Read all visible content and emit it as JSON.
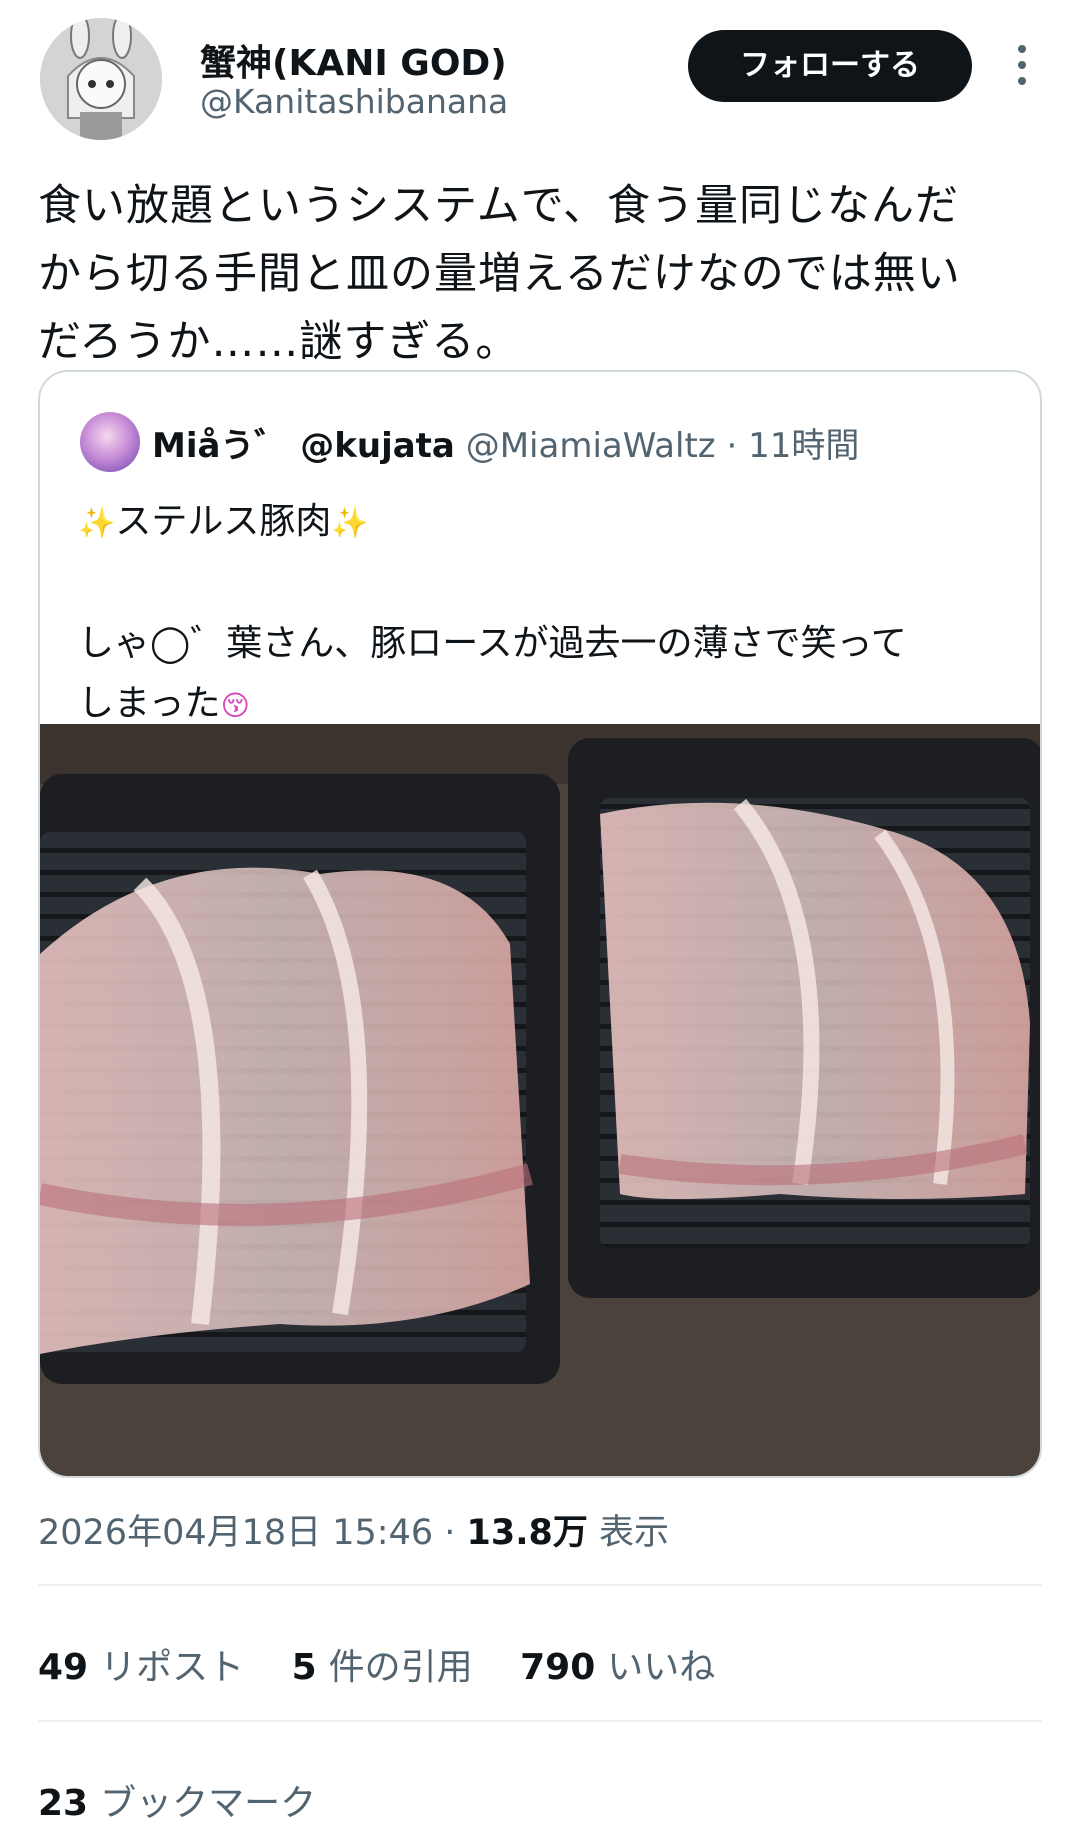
{
  "author": {
    "display_name": "蟹神(KANI GOD)",
    "handle": "@Kanitashibanana",
    "follow_label": "フォローする"
  },
  "tweet": {
    "lines": [
      "食い放題というシステムで、食う量同じなんだ",
      "から切る手間と皿の量増えるだけなのでは無い",
      "だろうか……謎すぎる。"
    ]
  },
  "quote": {
    "display_name": "Miåう゛ @kujata",
    "handle": "@MiamiaWaltz",
    "time": "11時間",
    "title_text": "ステルス豚肉",
    "body_lines": [
      "しゃ◯゛葉さん、豚ロースが過去一の薄さで笑って",
      "しまった"
    ],
    "sparkle_icon": "sparkles-icon",
    "kiss_icon": "kissing-face-icon"
  },
  "meta": {
    "timestamp": "2026年04月18日 15:46",
    "views_value": "13.8万",
    "views_label": "表示"
  },
  "stats": {
    "reposts_count": "49",
    "reposts_label": "リポスト",
    "quotes_count": "5",
    "quotes_label": "件の引用",
    "likes_count": "790",
    "likes_label": "いいね",
    "bookmarks_count": "23",
    "bookmarks_label": "ブックマーク"
  },
  "colors": {
    "text_primary": "#0f1419",
    "text_secondary": "#536471",
    "border": "#cfd9de"
  }
}
